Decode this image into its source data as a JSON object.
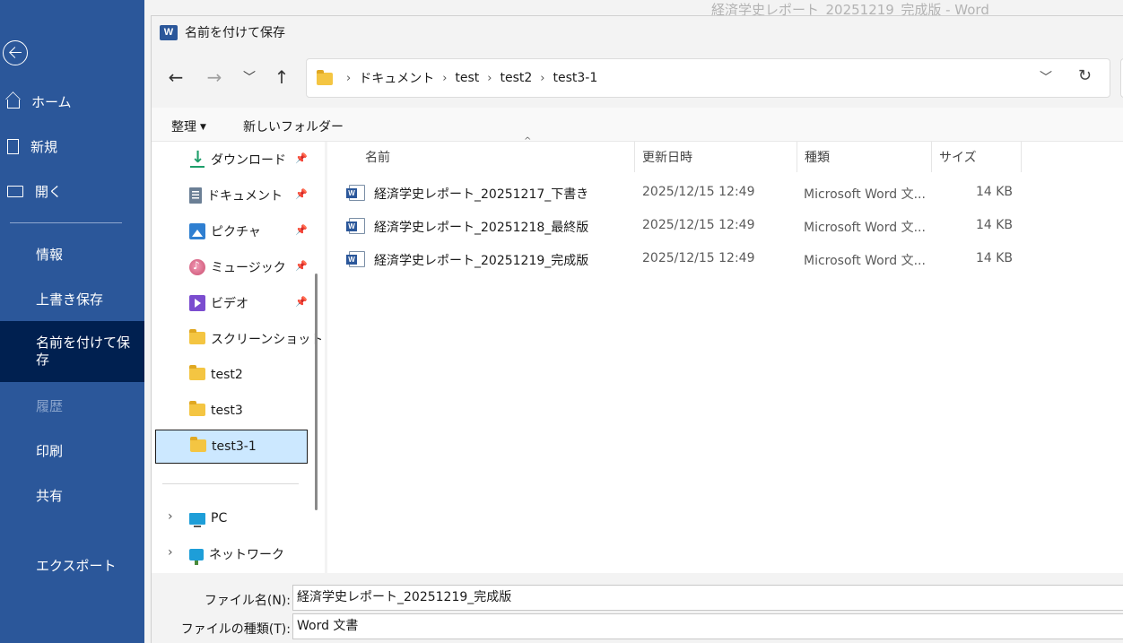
{
  "window_title": "経済学史レポート_20251219_完成版  -  Word",
  "backstage": {
    "items": [
      {
        "label": "ホーム"
      },
      {
        "label": "新規"
      },
      {
        "label": "開く"
      },
      {
        "label": "情報"
      },
      {
        "label": "上書き保存"
      },
      {
        "label": "名前を付けて保存"
      },
      {
        "label": "履歴"
      },
      {
        "label": "印刷"
      },
      {
        "label": "共有"
      },
      {
        "label": "エクスポート"
      }
    ]
  },
  "dialog": {
    "title": "名前を付けて保存",
    "logo_letter": "W",
    "breadcrumbs": [
      "ドキュメント",
      "test",
      "test2",
      "test3-1"
    ],
    "toolbar": {
      "organize": "整理",
      "new_folder": "新しいフォルダー"
    },
    "nav": [
      {
        "label": "ダウンロード",
        "icon": "download-icon",
        "pinned": true
      },
      {
        "label": "ドキュメント",
        "icon": "documents-icon",
        "pinned": true
      },
      {
        "label": "ピクチャ",
        "icon": "pictures-icon",
        "pinned": true
      },
      {
        "label": "ミュージック",
        "icon": "music-icon",
        "pinned": true
      },
      {
        "label": "ビデオ",
        "icon": "video-icon",
        "pinned": true
      },
      {
        "label": "スクリーンショット",
        "icon": "folder-icon",
        "pinned": false
      },
      {
        "label": "test2",
        "icon": "folder-icon",
        "pinned": false
      },
      {
        "label": "test3",
        "icon": "folder-icon",
        "pinned": false
      },
      {
        "label": "test3-1",
        "icon": "folder-icon",
        "pinned": false,
        "selected": true
      },
      {
        "label": "PC",
        "icon": "pc-icon",
        "expandable": true
      },
      {
        "label": "ネットワーク",
        "icon": "network-icon",
        "expandable": true
      }
    ],
    "columns": {
      "name": "名前",
      "date": "更新日時",
      "type": "種類",
      "size": "サイズ"
    },
    "files": [
      {
        "name": "経済学史レポート_20251217_下書き",
        "date": "2025/12/15 12:49",
        "type": "Microsoft Word 文...",
        "size": "14 KB"
      },
      {
        "name": "経済学史レポート_20251218_最終版",
        "date": "2025/12/15 12:49",
        "type": "Microsoft Word 文...",
        "size": "14 KB"
      },
      {
        "name": "経済学史レポート_20251219_完成版",
        "date": "2025/12/15 12:49",
        "type": "Microsoft Word 文...",
        "size": "14 KB"
      }
    ],
    "filename_label": "ファイル名(N):",
    "filename_value": "経済学史レポート_20251219_完成版",
    "filetype_label": "ファイルの種類(T):",
    "filetype_value": "Word 文書"
  }
}
